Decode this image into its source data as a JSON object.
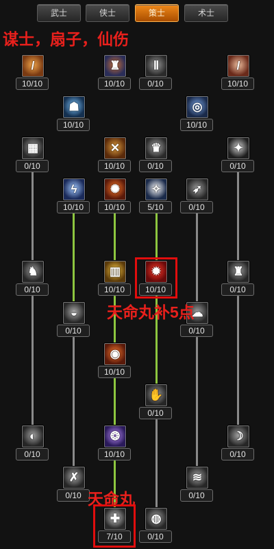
{
  "tabs": [
    {
      "label": "武士",
      "active": false
    },
    {
      "label": "侠士",
      "active": false
    },
    {
      "label": "策士",
      "active": true
    },
    {
      "label": "术士",
      "active": false
    }
  ],
  "overlay": {
    "title": "谋士，扇子，仙伤",
    "note_heaven": "天命丸补5点",
    "note_pill": "天命丸"
  },
  "skills": [
    {
      "id": "r1c1",
      "value": "10/10",
      "icon": "torch-staff-icon",
      "colors": [
        "#7a3a12",
        "#f3a64a"
      ],
      "glyph": "/"
    },
    {
      "id": "r1c3",
      "value": "10/10",
      "icon": "warrior-icon",
      "colors": [
        "#2a2d58",
        "#c8703a"
      ],
      "glyph": "♜"
    },
    {
      "id": "r1c4",
      "value": "0/10",
      "icon": "legs-icon",
      "colors": [
        "#2a2a2a",
        "#9a9a9a"
      ],
      "glyph": "Ⅱ"
    },
    {
      "id": "r1c6",
      "value": "10/10",
      "icon": "staff-icon",
      "colors": [
        "#6a2a1a",
        "#f0c0a0"
      ],
      "glyph": "/"
    },
    {
      "id": "r2c2",
      "value": "10/10",
      "icon": "body-glow-icon",
      "colors": [
        "#143050",
        "#7ec6ff"
      ],
      "glyph": "☗"
    },
    {
      "id": "r2c5",
      "value": "10/10",
      "icon": "vortex-icon",
      "colors": [
        "#1a2a4a",
        "#7aa6e8"
      ],
      "glyph": "◎"
    },
    {
      "id": "r3c1",
      "value": "0/10",
      "icon": "barrel-icon",
      "colors": [
        "#2a2a2a",
        "#9a9a9a"
      ],
      "glyph": "▦"
    },
    {
      "id": "r3c3",
      "value": "10/10",
      "icon": "crossed-swords-icon",
      "colors": [
        "#5a2a0a",
        "#e0a040"
      ],
      "glyph": "✕"
    },
    {
      "id": "r3c4",
      "value": "0/10",
      "icon": "helmet-icon",
      "colors": [
        "#2a2a2a",
        "#a8a8a8"
      ],
      "glyph": "♛"
    },
    {
      "id": "r3c6",
      "value": "0/10",
      "icon": "sparkle-icon",
      "colors": [
        "#1e1e1e",
        "#d0d0d0"
      ],
      "glyph": "✦"
    },
    {
      "id": "r4c2",
      "value": "10/10",
      "icon": "lightning-icon",
      "colors": [
        "#1a2a5a",
        "#a0c8ff"
      ],
      "glyph": "ϟ"
    },
    {
      "id": "r4c3",
      "value": "10/10",
      "icon": "fire-rune-icon",
      "colors": [
        "#5a1a0a",
        "#ff7a2a"
      ],
      "glyph": "✺"
    },
    {
      "id": "r4c4",
      "value": "5/10",
      "icon": "whirl-icon",
      "colors": [
        "#1a2a4a",
        "#ffffff"
      ],
      "glyph": "✧"
    },
    {
      "id": "r4c5",
      "value": "0/10",
      "icon": "wing-slash-icon",
      "colors": [
        "#262626",
        "#9a9a9a"
      ],
      "glyph": "➶"
    },
    {
      "id": "r5c1",
      "value": "0/10",
      "icon": "beast-icon",
      "colors": [
        "#262626",
        "#9a9a9a"
      ],
      "glyph": "♞"
    },
    {
      "id": "r5c3",
      "value": "10/10",
      "icon": "golden-cage-icon",
      "colors": [
        "#5a3a0a",
        "#ffcc44"
      ],
      "glyph": "▥"
    },
    {
      "id": "r5c4",
      "value": "10/10",
      "icon": "red-burst-icon",
      "colors": [
        "#6a0a0a",
        "#ff3a2a"
      ],
      "glyph": "✹"
    },
    {
      "id": "r5c6",
      "value": "0/10",
      "icon": "helm-spike-icon",
      "colors": [
        "#262626",
        "#a0a0a0"
      ],
      "glyph": "♜"
    },
    {
      "id": "r6c2",
      "value": "0/10",
      "icon": "bowl-icon",
      "colors": [
        "#262626",
        "#a8a8a8"
      ],
      "glyph": "◒"
    },
    {
      "id": "r6c5",
      "value": "0/10",
      "icon": "ghost-icon",
      "colors": [
        "#262626",
        "#a0a0a0"
      ],
      "glyph": "☁"
    },
    {
      "id": "r7c3",
      "value": "10/10",
      "icon": "flame-ring-icon",
      "colors": [
        "#5a1a0a",
        "#ff7a30"
      ],
      "glyph": "◉"
    },
    {
      "id": "r8c4",
      "value": "0/10",
      "icon": "hand-icon",
      "colors": [
        "#262626",
        "#a0a0a0"
      ],
      "glyph": "✋"
    },
    {
      "id": "r9c1",
      "value": "0/10",
      "icon": "eye-icon",
      "colors": [
        "#262626",
        "#a0a0a0"
      ],
      "glyph": "◐"
    },
    {
      "id": "r9c3",
      "value": "10/10",
      "icon": "purple-swirl-icon",
      "colors": [
        "#2a1a5a",
        "#c090ff"
      ],
      "glyph": "❂"
    },
    {
      "id": "r9c6",
      "value": "0/10",
      "icon": "spirit-icon",
      "colors": [
        "#262626",
        "#a0a0a0"
      ],
      "glyph": "☽"
    },
    {
      "id": "r10c2",
      "value": "0/10",
      "icon": "cross-blades-icon",
      "colors": [
        "#262626",
        "#a8a8a8"
      ],
      "glyph": "✗"
    },
    {
      "id": "r10c5",
      "value": "0/10",
      "icon": "mist-icon",
      "colors": [
        "#262626",
        "#a0a0a0"
      ],
      "glyph": "≋"
    },
    {
      "id": "r11c3",
      "value": "7/10",
      "icon": "pill-icon",
      "colors": [
        "#2a2a2a",
        "#c8c8c8"
      ],
      "glyph": "✚"
    },
    {
      "id": "r11c4",
      "value": "0/10",
      "icon": "shade-icon",
      "colors": [
        "#262626",
        "#a0a0a0"
      ],
      "glyph": "◍"
    }
  ]
}
